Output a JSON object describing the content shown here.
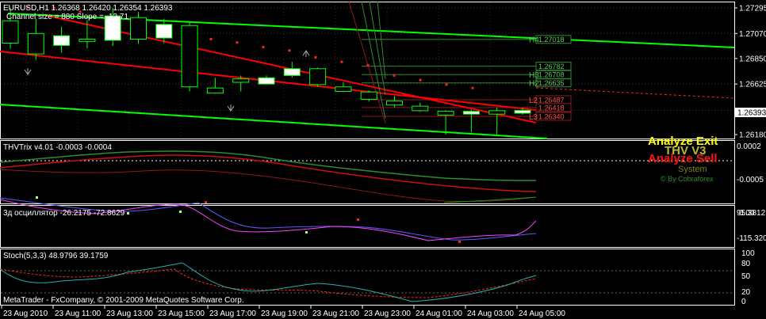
{
  "colors": {
    "background": "#000000",
    "grid": "#ffffff",
    "bull_candle": "#ffffff",
    "bear_candle": "#000000",
    "candle_outline": "#00ff00",
    "channel_green": "#00ff00",
    "channel_red": "#ff0000",
    "level_green": "#2e8b2e",
    "level_red": "#8b1a1a",
    "pivot_dot": "#ff2020",
    "accent_yellow": "#ffff00",
    "oscillator_magenta": "#ff40ff",
    "oscillator_blue": "#6060ff",
    "stoch_main": "#20b2aa",
    "stoch_signal": "#ff2020"
  },
  "main_panel": {
    "header_line1": "EURUSD,H1  1.26368 1.26420 1.26354 1.26393",
    "header_line2": "Channel size = 880 Slope = -12.71",
    "current_price": "1.26393",
    "price_axis": [
      "1.27295",
      "1.27070",
      "1.26850",
      "1.26625",
      "1.26393",
      "1.26180"
    ],
    "levels": [
      {
        "tag": "H4",
        "price": "1.27018",
        "kind": "green"
      },
      {
        "tag": "",
        "price": "1.26782",
        "kind": "green"
      },
      {
        "tag": "H3",
        "price": "1.26708",
        "kind": "green"
      },
      {
        "tag": "H2",
        "price": "1.26635",
        "kind": "green"
      },
      {
        "tag": "L2",
        "price": "1.26487",
        "kind": "red"
      },
      {
        "tag": "",
        "price": "1.26418",
        "kind": "red"
      },
      {
        "tag": "L3",
        "price": "1.26340",
        "kind": "red"
      }
    ],
    "candles": [
      {
        "o": 1.27182,
        "h": 1.27295,
        "l": 1.26935,
        "c": 1.26985
      },
      {
        "o": 1.2707,
        "h": 1.272,
        "l": 1.2684,
        "c": 1.2689
      },
      {
        "o": 1.26965,
        "h": 1.2713,
        "l": 1.269,
        "c": 1.2705
      },
      {
        "o": 1.2702,
        "h": 1.2719,
        "l": 1.2694,
        "c": 1.27
      },
      {
        "o": 1.2701,
        "h": 1.27295,
        "l": 1.2696,
        "c": 1.27225
      },
      {
        "o": 1.2721,
        "h": 1.2726,
        "l": 1.2698,
        "c": 1.2702
      },
      {
        "o": 1.2703,
        "h": 1.272,
        "l": 1.26985,
        "c": 1.2715
      },
      {
        "o": 1.2714,
        "h": 1.2717,
        "l": 1.2656,
        "c": 1.266
      },
      {
        "o": 1.2659,
        "h": 1.2668,
        "l": 1.2654,
        "c": 1.26545
      },
      {
        "o": 1.2667,
        "h": 1.267,
        "l": 1.2656,
        "c": 1.2664
      },
      {
        "o": 1.26625,
        "h": 1.267,
        "l": 1.2665,
        "c": 1.2668
      },
      {
        "o": 1.267,
        "h": 1.2682,
        "l": 1.2668,
        "c": 1.2676
      },
      {
        "o": 1.2676,
        "h": 1.2677,
        "l": 1.266,
        "c": 1.2662
      },
      {
        "o": 1.266,
        "h": 1.2664,
        "l": 1.26555,
        "c": 1.2656
      },
      {
        "o": 1.26555,
        "h": 1.2657,
        "l": 1.2647,
        "c": 1.2649
      },
      {
        "o": 1.26475,
        "h": 1.2652,
        "l": 1.2642,
        "c": 1.2644
      },
      {
        "o": 1.2643,
        "h": 1.2646,
        "l": 1.2638,
        "c": 1.2639
      },
      {
        "o": 1.26385,
        "h": 1.26395,
        "l": 1.2618,
        "c": 1.2635
      },
      {
        "o": 1.2636,
        "h": 1.264,
        "l": 1.262,
        "c": 1.26385
      },
      {
        "o": 1.2639,
        "h": 1.2642,
        "l": 1.2618,
        "c": 1.2636
      },
      {
        "o": 1.26368,
        "h": 1.2642,
        "l": 1.26354,
        "c": 1.26393
      }
    ],
    "pivots": [
      1.273,
      1.27295,
      1.2726,
      1.2721,
      1.2718,
      1.2714,
      1.2708,
      1.2702,
      1.2699,
      1.2695,
      1.2692,
      1.2686,
      1.2682,
      1.2679,
      1.267,
      1.2666,
      1.2662,
      1.2659
    ]
  },
  "ea_overlay": {
    "exit_text": "Analyze Exit",
    "thv_text": "THV V3",
    "sell_text": "Analyze Sell",
    "system_text": "System",
    "credit_text": "© By Cobraforex"
  },
  "panel_thv": {
    "title": "THVTrix v4.01 -0.0003 -0.0004",
    "axis": [
      "0.0002",
      "-0.0005"
    ]
  },
  "panel_osc": {
    "title": "3д осциллятор -26.2175 -72.8629",
    "axis": [
      "95.3812",
      "0.00",
      "-115.3201"
    ]
  },
  "panel_stoch": {
    "title": "Stoch(5,3,3) 48.9796 39.1759",
    "axis": [
      "100",
      "80",
      "50",
      "20",
      "0"
    ],
    "copyright": "MetaTrader - FxCompany, © 2001-2009 MetaQuotes Software Corp."
  },
  "time_axis": [
    "23 Aug 2010",
    "23 Aug 11:00",
    "23 Aug 13:00",
    "23 Aug 15:00",
    "23 Aug 17:00",
    "23 Aug 19:00",
    "23 Aug 21:00",
    "23 Aug 23:00",
    "24 Aug 01:00",
    "24 Aug 03:00",
    "24 Aug 05:00"
  ]
}
